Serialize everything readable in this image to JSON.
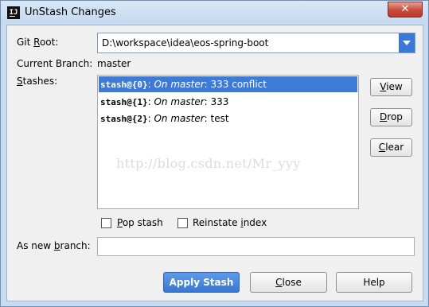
{
  "window": {
    "title": "UnStash Changes",
    "app_icon_text": "IJ",
    "close_glyph": "✕"
  },
  "form": {
    "git_root_label_pre": "Git ",
    "git_root_label_ul": "R",
    "git_root_label_post": "oot:",
    "git_root_value": "D:\\workspace\\idea\\eos-spring-boot",
    "current_branch_label": "Current Branch:",
    "current_branch_value": "master",
    "stashes_label_ul": "S",
    "stashes_label_post": "tashes:"
  },
  "stashes": [
    {
      "id": "stash@{0}",
      "sep": ": ",
      "on": "On master",
      "message": ": 333 conflict",
      "selected": true
    },
    {
      "id": "stash@{1}",
      "sep": ": ",
      "on": "On master",
      "message": ": 333",
      "selected": false
    },
    {
      "id": "stash@{2}",
      "sep": ": ",
      "on": "On master",
      "message": ": test",
      "selected": false
    }
  ],
  "side_buttons": {
    "view_ul": "V",
    "view_rest": "iew",
    "drop_ul": "D",
    "drop_rest": "rop",
    "clear_ul": "C",
    "clear_rest": "lear"
  },
  "options": {
    "pop_ul": "P",
    "pop_rest": "op stash",
    "reinstate_pre": "Reinstate ",
    "reinstate_ul": "i",
    "reinstate_post": "ndex"
  },
  "new_branch": {
    "label_pre": "As new ",
    "label_ul": "b",
    "label_post": "ranch:",
    "value": ""
  },
  "bottom_buttons": {
    "apply": "Apply Stash",
    "close_ul": "C",
    "close_rest": "lose",
    "help": "Help"
  },
  "watermark": "http://blog.csdn.net/Mr_yyy",
  "colors": {
    "accent": "#3d7bd6",
    "frame": "#c9dcef",
    "dialog_bg": "#f0f0f0"
  }
}
